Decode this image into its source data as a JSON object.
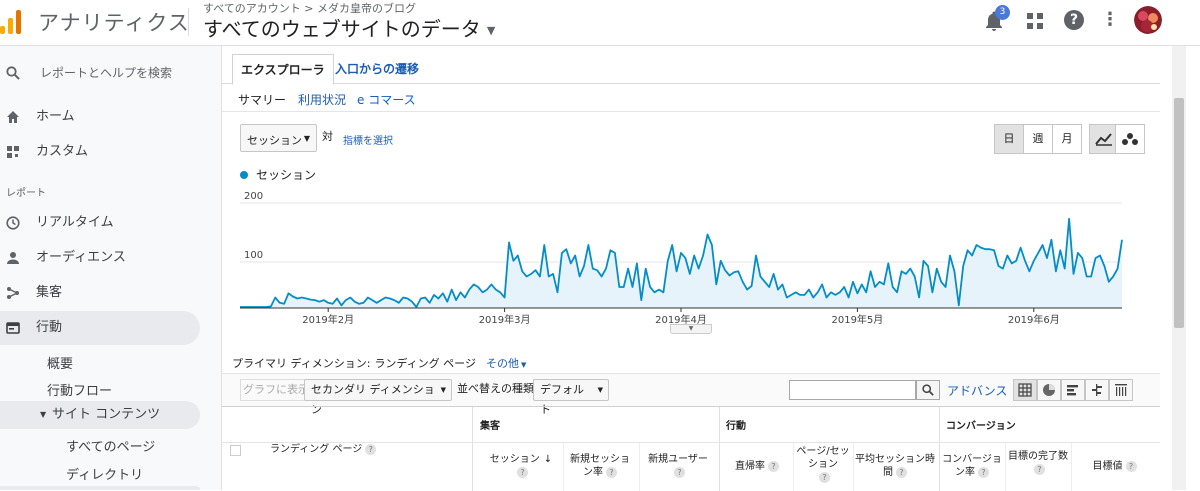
{
  "header": {
    "app_name": "アナリティクス",
    "breadcrumb": "すべてのアカウント > メダカ皇帝のブログ",
    "property": "すべてのウェブサイトのデータ",
    "notification_count": "3",
    "help_symbol": "?",
    "more_symbol": "⋮"
  },
  "sidebar": {
    "search_placeholder": "レポートとヘルプを検索",
    "home": "ホーム",
    "custom": "カスタム",
    "section_label": "レポート",
    "realtime": "リアルタイム",
    "audience": "オーディエンス",
    "acquisition": "集客",
    "behavior": "行動",
    "overview": "概要",
    "behavior_flow": "行動フロー",
    "site_content": "サイト コンテンツ",
    "all_pages": "すべてのページ",
    "directory": "ディレクトリ"
  },
  "tabs": {
    "explorer": "エクスプローラ",
    "entrance": "入口からの遷移",
    "summary": "サマリー",
    "usage": "利用状況",
    "ecommerce": "e コマース"
  },
  "chart_controls": {
    "metric": "セッション",
    "vs": "対",
    "choose_metric": "指標を選択",
    "day": "日",
    "week": "週",
    "month": "月"
  },
  "chart_data": {
    "type": "area",
    "legend": "セッション",
    "y_ticks": [
      "200",
      "100"
    ],
    "ylim": [
      0,
      200
    ],
    "x_tick_labels": [
      "2019年2月",
      "2019年3月",
      "2019年4月",
      "2019年5月",
      "2019年6月"
    ],
    "color": "#058dc7",
    "values": [
      2,
      2,
      2,
      2,
      2,
      2,
      2,
      3,
      20,
      10,
      8,
      28,
      22,
      18,
      20,
      18,
      16,
      15,
      12,
      15,
      10,
      8,
      18,
      5,
      15,
      20,
      12,
      8,
      10,
      20,
      15,
      10,
      15,
      20,
      18,
      15,
      10,
      20,
      18,
      12,
      2,
      18,
      20,
      10,
      25,
      18,
      28,
      12,
      35,
      15,
      30,
      20,
      35,
      45,
      40,
      30,
      35,
      45,
      35,
      30,
      20,
      125,
      90,
      100,
      70,
      60,
      65,
      72,
      60,
      120,
      60,
      65,
      30,
      105,
      112,
      85,
      100,
      60,
      80,
      120,
      75,
      72,
      60,
      75,
      110,
      105,
      40,
      40,
      75,
      40,
      85,
      15,
      75,
      40,
      30,
      35,
      30,
      90,
      120,
      70,
      105,
      95,
      65,
      100,
      75,
      100,
      140,
      120,
      45,
      90,
      72,
      62,
      68,
      70,
      50,
      35,
      42,
      100,
      60,
      50,
      40,
      65,
      35,
      45,
      20,
      25,
      30,
      25,
      25,
      35,
      20,
      30,
      45,
      20,
      30,
      25,
      30,
      40,
      20,
      50,
      28,
      45,
      30,
      70,
      40,
      50,
      45,
      85,
      40,
      30,
      70,
      65,
      75,
      60,
      20,
      90,
      80,
      30,
      75,
      50,
      40,
      100,
      70,
      5,
      80,
      110,
      100,
      120,
      115,
      112,
      112,
      110,
      80,
      75,
      100,
      85,
      90,
      115,
      90,
      70,
      90,
      105,
      120,
      95,
      130,
      70,
      110,
      75,
      170,
      65,
      105,
      95,
      60,
      60,
      95,
      100,
      80,
      50,
      60,
      75,
      130
    ]
  },
  "table_controls": {
    "primary_dimension_label": "プライマリ ディメンション:",
    "primary_dimension_value": "ランディング ページ",
    "other": "その他",
    "graph_show": "グラフに表示",
    "secondary_dimension": "セカンダリ ディメンション",
    "sort_label": "並べ替えの種類:",
    "sort_value": "デフォルト",
    "advanced": "アドバンス"
  },
  "table": {
    "group_acquisition": "集客",
    "group_behavior": "行動",
    "group_conversion": "コンバージョン",
    "col_landing": "ランディング ページ",
    "col_sessions": "セッション",
    "col_new_session_rate": "新規セッション率",
    "col_new_users": "新規ユーザー",
    "col_bounce": "直帰率",
    "col_pages_per_session": "ページ/セッション",
    "col_avg_duration": "平均セッション時間",
    "col_conversion_rate": "コンバージョン率",
    "col_goal_completions": "目標の完了数",
    "col_goal_value": "目標値"
  }
}
